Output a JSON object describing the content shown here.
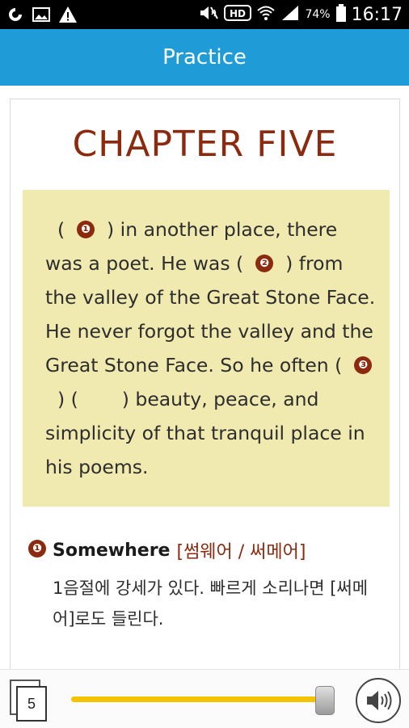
{
  "status_bar": {
    "battery_percent": "74%",
    "time": "16:17",
    "icons": [
      "notification-app-icon",
      "image-icon",
      "warning-icon",
      "mute-icon",
      "hd-icon",
      "wifi-icon",
      "signal-icon",
      "battery-icon"
    ]
  },
  "app_bar": {
    "title": "Practice"
  },
  "chapter": {
    "title": "CHAPTER FIVE"
  },
  "passage": {
    "seg1": "(",
    "mark1": "❶",
    "seg2": ") in another place, there was a poet. He was (",
    "mark2": "❷",
    "seg3": ") from the valley of the Great Stone Face. He never forgot the valley and the Great Stone Face. So he often (",
    "mark3": "❸",
    "seg4": ") (",
    "seg5": ") beauty, peace, and simplicity of that tranquil place in his poems."
  },
  "note": {
    "marker": "❶",
    "word": "Somewhere",
    "pronunciation": "[썸웨어 / 써메어]",
    "body": "1음절에 강세가 있다. 빠르게 소리나면 [써메어]로도 들린다."
  },
  "bottom_bar": {
    "page_number": "5",
    "slider_level": 0.95,
    "accent_color": "#f5c200"
  },
  "colors": {
    "app_bar": "#1f9bd8",
    "chapter_title": "#8b2a0f",
    "passage_bg": "#f1eab0"
  }
}
